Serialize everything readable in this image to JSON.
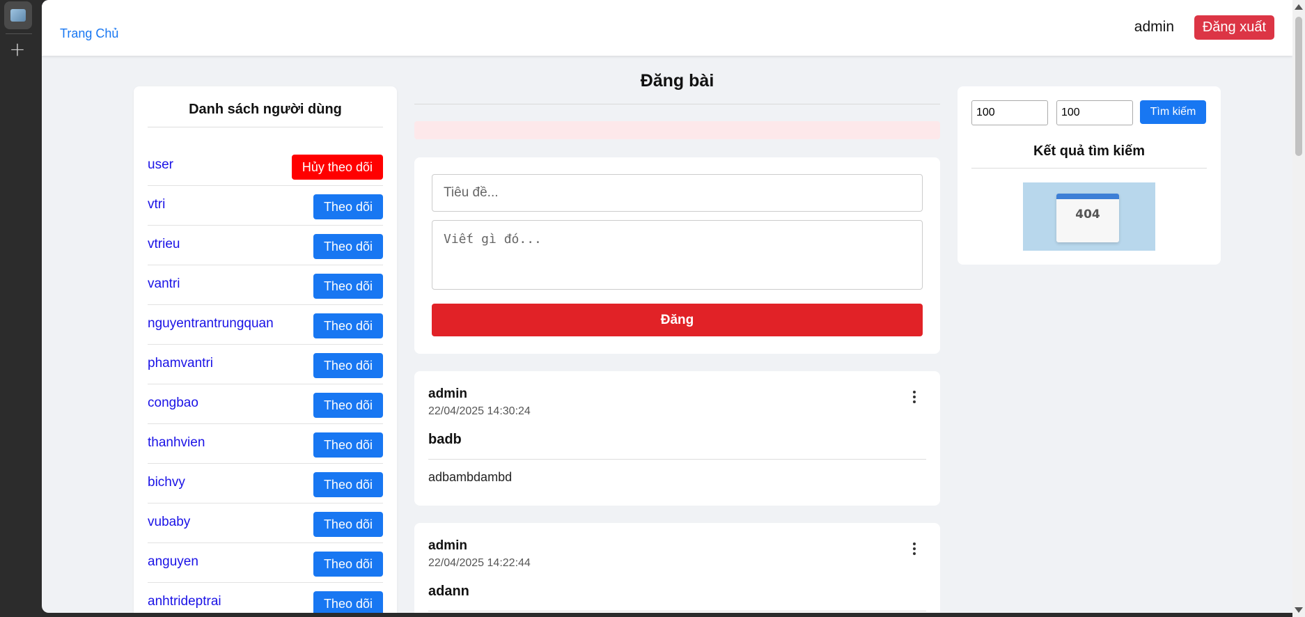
{
  "header": {
    "home_link": "Trang Chủ",
    "username": "admin",
    "logout_label": "Đăng xuất"
  },
  "users_panel": {
    "title": "Danh sách người dùng",
    "users": [
      {
        "name": "user",
        "action": "Hủy theo dõi"
      },
      {
        "name": "vtri",
        "action": "Theo dõi"
      },
      {
        "name": "vtrieu",
        "action": "Theo dõi"
      },
      {
        "name": "vantri",
        "action": "Theo dõi"
      },
      {
        "name": "nguyentrantrungquan",
        "action": "Theo dõi"
      },
      {
        "name": "phamvantri",
        "action": "Theo dõi"
      },
      {
        "name": "congbao",
        "action": "Theo dõi"
      },
      {
        "name": "thanhvien",
        "action": "Theo dõi"
      },
      {
        "name": "bichvy",
        "action": "Theo dõi"
      },
      {
        "name": "vubaby",
        "action": "Theo dõi"
      },
      {
        "name": "anguyen",
        "action": "Theo dõi"
      },
      {
        "name": "anhtrideptrai",
        "action": "Theo dõi"
      }
    ]
  },
  "compose": {
    "page_title": "Đăng bài",
    "title_placeholder": "Tiêu đề...",
    "body_placeholder": "Viết gì đó...",
    "submit_label": "Đăng"
  },
  "posts": [
    {
      "author": "admin",
      "time": "22/04/2025 14:30:24",
      "title": "badb",
      "body": "adbambdambd"
    },
    {
      "author": "admin",
      "time": "22/04/2025 14:22:44",
      "title": "adann",
      "body": ""
    }
  ],
  "search": {
    "value_a": "100",
    "value_b": "100",
    "button_label": "Tìm kiếm",
    "results_title": "Kết quả tìm kiếm",
    "result_image_text": "404"
  },
  "colors": {
    "accent": "#1877f2",
    "danger": "#dc3545",
    "unfollow": "#ff0000",
    "post_button": "#e12227"
  }
}
